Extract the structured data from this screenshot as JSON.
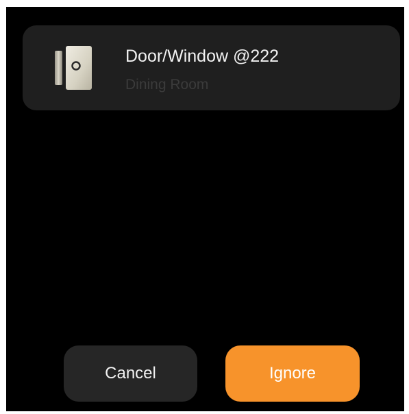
{
  "device": {
    "name": "Door/Window @222",
    "room": "Dining Room",
    "icon": "door-window-sensor-icon"
  },
  "actions": {
    "cancel_label": "Cancel",
    "ignore_label": "Ignore"
  },
  "colors": {
    "background": "#000000",
    "card": "#1f1f1f",
    "cancel_button": "#262626",
    "accent": "#f7932b"
  }
}
